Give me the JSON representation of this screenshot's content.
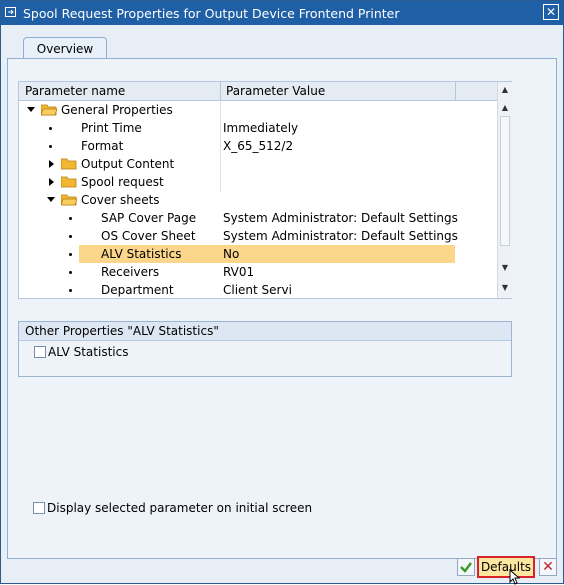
{
  "window": {
    "title": "Spool Request Properties for Output Device Frontend Printer"
  },
  "tabs": [
    {
      "label": "Overview"
    }
  ],
  "grid": {
    "headers": [
      "Parameter name",
      "Parameter Value"
    ],
    "rows": [
      {
        "name": "General Properties",
        "value": ""
      },
      {
        "name": "Print Time",
        "value": "Immediately"
      },
      {
        "name": "Format",
        "value": "X_65_512/2"
      },
      {
        "name": "Output Content",
        "value": ""
      },
      {
        "name": "Spool request",
        "value": ""
      },
      {
        "name": "Cover sheets",
        "value": ""
      },
      {
        "name": "SAP Cover Page",
        "value": "System Administrator: Default Settings"
      },
      {
        "name": "OS Cover Sheet",
        "value": "System Administrator: Default Settings"
      },
      {
        "name": "ALV Statistics",
        "value": "No"
      },
      {
        "name": "Receivers",
        "value": "RV01"
      },
      {
        "name": "Department",
        "value": "Client Servi"
      }
    ]
  },
  "other_properties": {
    "title": "Other Properties \"ALV Statistics\"",
    "checkbox_label": "ALV Statistics"
  },
  "footer": {
    "display_checkbox_label": "Display selected parameter on initial screen",
    "defaults_label": "Defaults"
  },
  "colors": {
    "titlebar": "#1f5fa6",
    "highlight": "#fcd68a",
    "accent_red": "#d8232a"
  }
}
